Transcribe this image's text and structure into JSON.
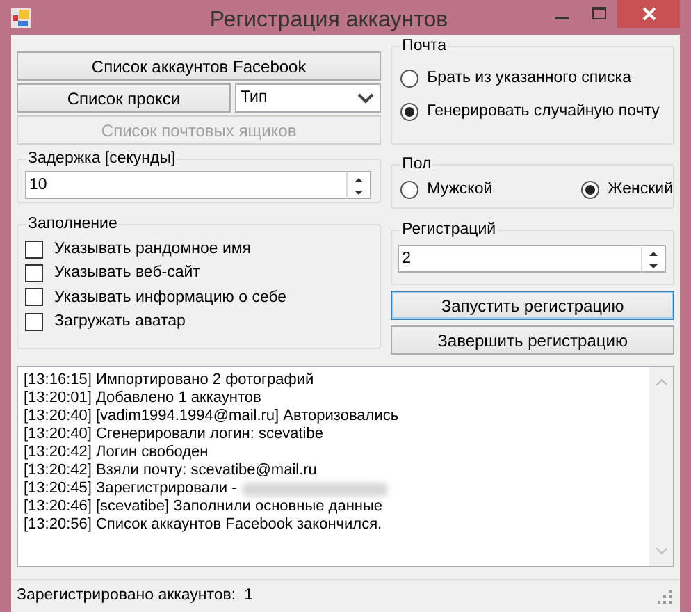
{
  "window": {
    "title": "Регистрация аккаунтов"
  },
  "left_buttons": [
    {
      "label": "Список аккаунтов Facebook",
      "disabled": false
    },
    {
      "label": "Список прокси",
      "disabled": false
    },
    {
      "label": "Список почтовых ящиков",
      "disabled": true
    }
  ],
  "proxy_type": {
    "value": "Тип"
  },
  "mail": {
    "title": "Почта",
    "options": [
      {
        "label": "Брать из указанного списка",
        "selected": false
      },
      {
        "label": "Генерировать случайную почту",
        "selected": true
      }
    ]
  },
  "delay": {
    "title": "Задержка [секунды]",
    "value": "10"
  },
  "gender": {
    "title": "Пол",
    "options": [
      {
        "label": "Мужской",
        "selected": false
      },
      {
        "label": "Женский",
        "selected": true
      }
    ]
  },
  "fill": {
    "title": "Заполнение",
    "checkboxes": [
      {
        "label": "Указывать рандомное имя",
        "checked": false
      },
      {
        "label": "Указывать веб-сайт",
        "checked": false
      },
      {
        "label": "Указывать информацию о себе",
        "checked": false
      },
      {
        "label": "Загружать аватар",
        "checked": false
      }
    ]
  },
  "registrations": {
    "title": "Регистраций",
    "value": "2"
  },
  "actions": [
    {
      "label": "Запустить регистрацию",
      "focused": true
    },
    {
      "label": "Завершить регистрацию",
      "focused": false
    }
  ],
  "log": [
    {
      "text": "[13:16:15] Импортировано 2 фотографий",
      "blurred": false
    },
    {
      "text": "[13:20:01] Добавлено 1 аккаунтов",
      "blurred": false
    },
    {
      "text": "[13:20:40] [vadim1994.1994@mail.ru] Авторизовались",
      "blurred": false
    },
    {
      "text": "[13:20:40] Сгенерировали логин: scevatibe",
      "blurred": false
    },
    {
      "text": "[13:20:42] Логин свободен",
      "blurred": false
    },
    {
      "text": "[13:20:42] Взяли почту: scevatibe@mail.ru",
      "blurred": false
    },
    {
      "text": "[13:20:45] Зарегистрировали -",
      "blurred": true
    },
    {
      "text": "[13:20:46] [scevatibe] Заполнили основные данные",
      "blurred": false
    },
    {
      "text": "[13:20:56] Список аккаунтов Facebook закончился.",
      "blurred": false
    }
  ],
  "status_bar": {
    "label": "Зарегистрировано аккаунтов:",
    "value": "1"
  }
}
